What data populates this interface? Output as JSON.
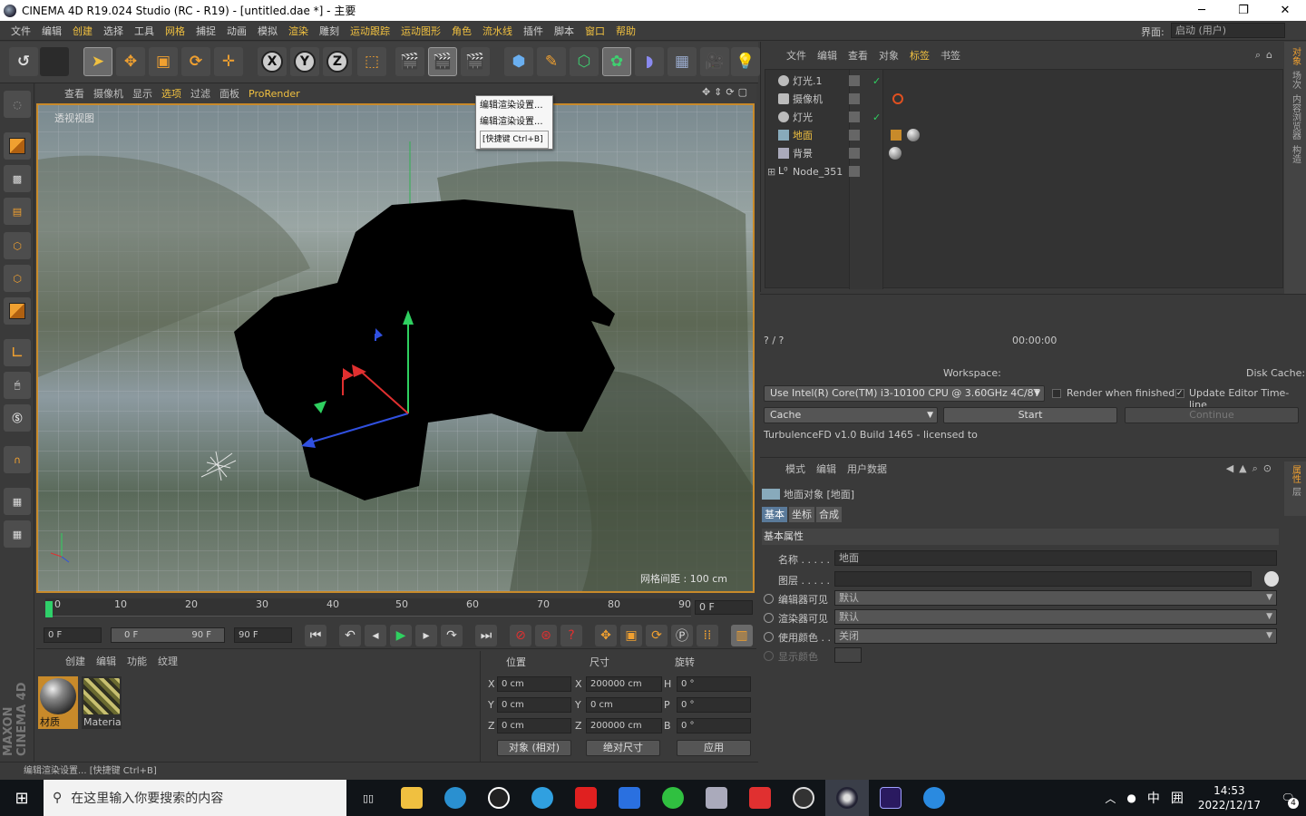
{
  "window": {
    "title": "CINEMA 4D R19.024 Studio (RC - R19) - [untitled.dae *] - 主要",
    "minimize": "─",
    "maximize": "❐",
    "close": "✕"
  },
  "menubar": {
    "items": [
      "文件",
      "编辑",
      "创建",
      "选择",
      "工具",
      "网格",
      "捕捉",
      "动画",
      "模拟",
      "渲染",
      "雕刻",
      "运动跟踪",
      "运动图形",
      "角色",
      "流水线",
      "插件",
      "脚本",
      "窗口",
      "帮助"
    ],
    "layout_label": "界面:",
    "layout_value": "启动 (用户)"
  },
  "toolbar": {
    "undo": "↺",
    "axis_x": "X",
    "axis_y": "Y",
    "axis_z": "Z"
  },
  "viewport": {
    "menu": [
      "查看",
      "摄像机",
      "显示",
      "选项",
      "过滤",
      "面板",
      "ProRender"
    ],
    "label": "透视视图",
    "grid_info": "网格间距 : 100 cm"
  },
  "popup": {
    "items": [
      "编辑渲染设置...",
      "编辑渲染设置...",
      "[快捷键 Ctrl+B]"
    ]
  },
  "timeline": {
    "ticks": [
      "0",
      "10",
      "20",
      "30",
      "40",
      "50",
      "60",
      "70",
      "80",
      "90"
    ],
    "end_field": "0 F"
  },
  "transport": {
    "start_field": "0 F",
    "range_start": "0 F",
    "range_end": "90 F",
    "end_field": "90 F"
  },
  "material_manager": {
    "menu": [
      "创建",
      "编辑",
      "功能",
      "纹理"
    ],
    "materials": [
      {
        "name": "材质"
      },
      {
        "name": "Materia"
      }
    ],
    "brand": "MAXON CINEMA 4D"
  },
  "coord_manager": {
    "headers": {
      "position": "位置",
      "size": "尺寸",
      "rotation": "旋转"
    },
    "rows": [
      {
        "axis": "X",
        "pos": "0 cm",
        "size_axis": "X",
        "size": "200000 cm",
        "rot_axis": "H",
        "rot": "0 °"
      },
      {
        "axis": "Y",
        "pos": "0 cm",
        "size_axis": "Y",
        "size": "0 cm",
        "rot_axis": "P",
        "rot": "0 °"
      },
      {
        "axis": "Z",
        "pos": "0 cm",
        "size_axis": "Z",
        "size": "200000 cm",
        "rot_axis": "B",
        "rot": "0 °"
      }
    ],
    "mode": "对象 (相对)",
    "size_mode": "绝对尺寸",
    "apply": "应用"
  },
  "statusbar": {
    "text": "编辑渲染设置... [快捷键 Ctrl+B]"
  },
  "object_manager": {
    "menu": [
      "文件",
      "编辑",
      "查看",
      "对象",
      "标签",
      "书签"
    ],
    "objects": [
      {
        "name": "灯光.1",
        "selected": false
      },
      {
        "name": "摄像机",
        "selected": false
      },
      {
        "name": "灯光",
        "selected": false
      },
      {
        "name": "地面",
        "selected": true
      },
      {
        "name": "背景",
        "selected": false
      },
      {
        "name": "Node_351",
        "selected": false
      }
    ]
  },
  "render_panel": {
    "progress": "? / ?",
    "time": "00:00:00",
    "workspace_label": "Workspace:",
    "disk_cache_label": "Disk Cache:",
    "cpu": "Use  Intel(R) Core(TM) i3-10100 CPU @ 3.60GHz 4C/8T",
    "render_when_finished": "Render when finished",
    "update_editor": "Update Editor Time-line",
    "cache": "Cache",
    "start": "Start",
    "continue": "Continue",
    "license": "TurbulenceFD v1.0 Build 1465 - licensed to"
  },
  "attributes": {
    "menu": [
      "模式",
      "编辑",
      "用户数据"
    ],
    "object_title": "地面对象 [地面]",
    "tabs": [
      "基本",
      "坐标",
      "合成"
    ],
    "section": "基本属性",
    "rows": [
      {
        "label": "名称 . . . . .",
        "value": "地面"
      },
      {
        "label": "图层 . . . . .",
        "value": ""
      },
      {
        "label": "编辑器可见",
        "value": "默认"
      },
      {
        "label": "渲染器可见",
        "value": "默认"
      },
      {
        "label": "使用颜色 . .",
        "value": "关闭"
      },
      {
        "label": "显示颜色",
        "value": ""
      }
    ]
  },
  "right_sidebar": [
    "对象",
    "场次",
    "内容浏览器",
    "构造"
  ],
  "attr_sidebar": [
    "属性",
    "层"
  ],
  "taskbar": {
    "search_placeholder": "在这里输入你要搜索的内容",
    "ime": "中",
    "ime2": "囲",
    "time": "14:53",
    "date": "2022/12/17",
    "notifications": "4"
  }
}
